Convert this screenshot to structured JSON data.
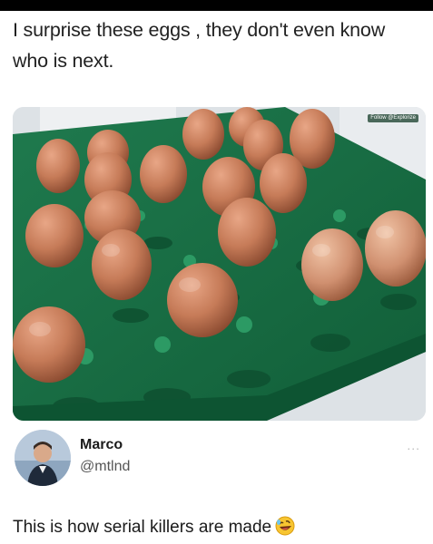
{
  "post": {
    "caption": "I surprise these eggs , they don't even know who is next.",
    "watermark": "Follow @Explorize"
  },
  "author": {
    "name": "Marco",
    "handle": "@mtlnd"
  },
  "more_label": "...",
  "reply": {
    "text": "This is how serial killers are made"
  },
  "icons": {
    "more": "ellipsis-icon",
    "emoji": "rolling-on-floor-laughing-emoji"
  }
}
